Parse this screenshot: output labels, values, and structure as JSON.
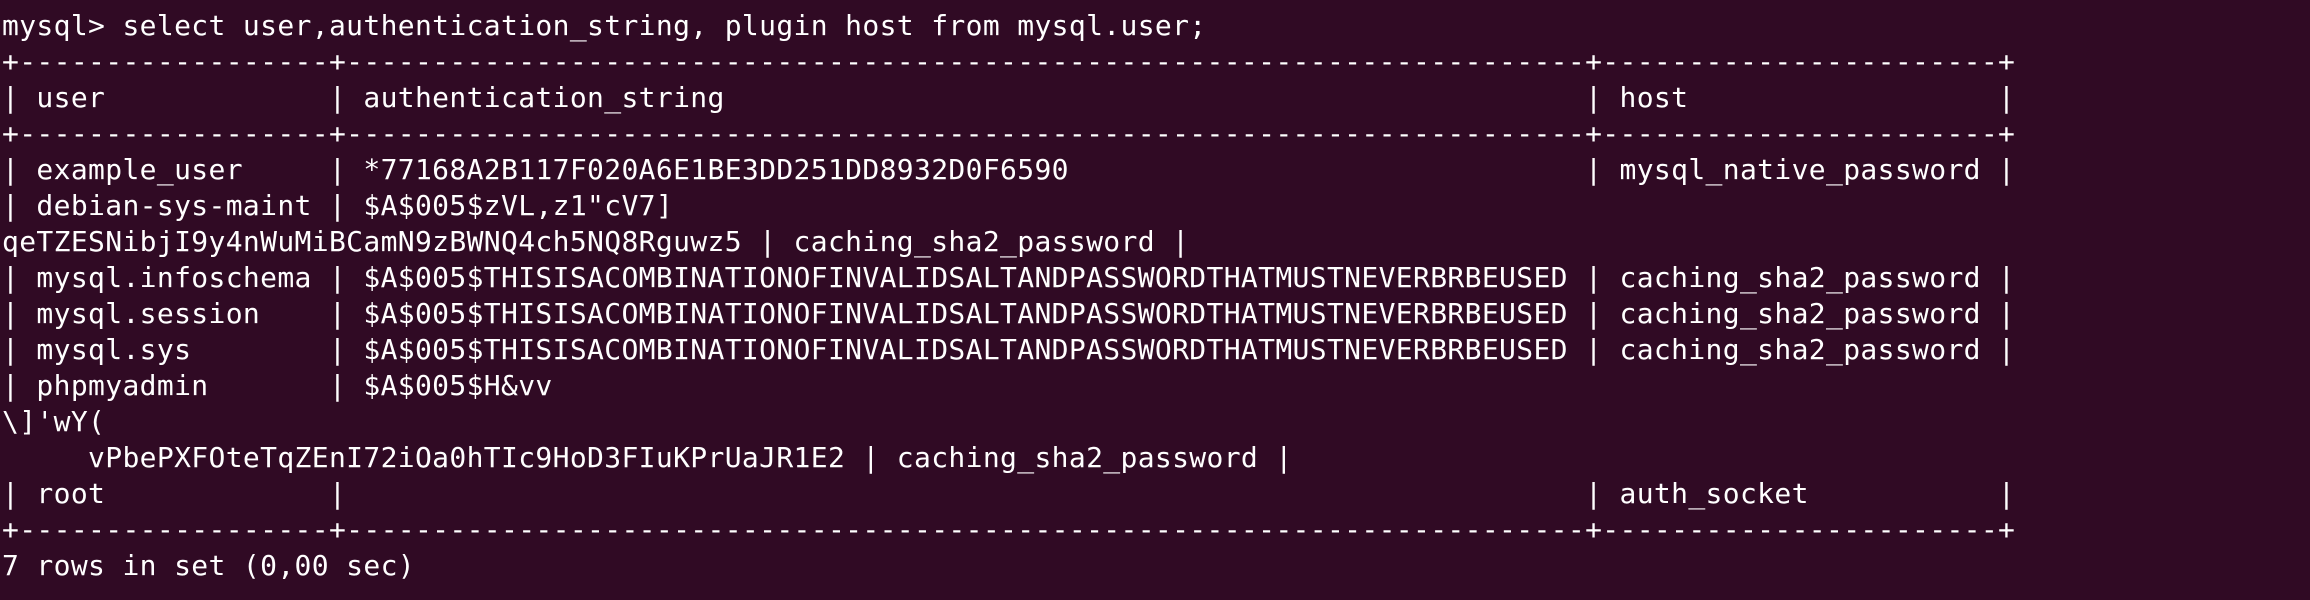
{
  "terminal": {
    "lines": [
      "mysql> select user,authentication_string, plugin host from mysql.user;",
      "+------------------+------------------------------------------------------------------------+-----------------------+",
      "| user             | authentication_string                                                  | host                  |",
      "+------------------+------------------------------------------------------------------------+-----------------------+",
      "| example_user     | *77168A2B117F020A6E1BE3DD251DD8932D0F6590                              | mysql_native_password |",
      "| debian-sys-maint | $A$005$zVL,z1\"cV7]",
      "qeTZESNibjI9y4nWuMiBCamN9zBWNQ4ch5NQ8Rguwz5 | caching_sha2_password |",
      "| mysql.infoschema | $A$005$THISISACOMBINATIONOFINVALIDSALTANDPASSWORDTHATMUSTNEVERBRBEUSED | caching_sha2_password |",
      "| mysql.session    | $A$005$THISISACOMBINATIONOFINVALIDSALTANDPASSWORDTHATMUSTNEVERBRBEUSED | caching_sha2_password |",
      "| mysql.sys        | $A$005$THISISACOMBINATIONOFINVALIDSALTANDPASSWORDTHATMUSTNEVERBRBEUSED | caching_sha2_password |",
      "| phpmyadmin       | $A$005$H&vv",
      "\\]'wY(",
      "     vPbePXFOteTqZEnI72iOa0hTIc9HoD3FIuKPrUaJR1E2 | caching_sha2_password |",
      "| root             |                                                                        | auth_socket           |",
      "+------------------+------------------------------------------------------------------------+-----------------------+",
      "7 rows in set (0,00 sec)"
    ]
  },
  "colors": {
    "background": "#300a24",
    "text": "#ffffff"
  }
}
